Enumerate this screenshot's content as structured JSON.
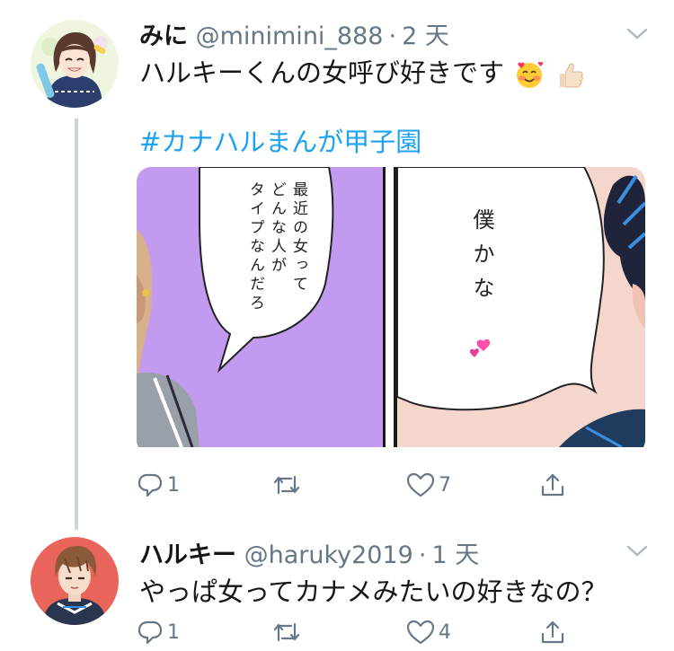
{
  "tweet1": {
    "name": "みに",
    "handle": "@minimini_888",
    "separator": "·",
    "time": "2 天",
    "text": "ハルキーくんの女呼び好きです",
    "hashtag": "#カナハルまんが甲子園",
    "emojis": [
      "smiling-face-with-hearts",
      "thumbs-up"
    ],
    "media": {
      "left_bubble": [
        "最近の女って",
        "どんな人が",
        "タイプなんだろ"
      ],
      "right_bubble": "僕かな"
    },
    "actions": {
      "reply_count": "1",
      "retweet_count": "",
      "like_count": "7"
    }
  },
  "tweet2": {
    "name": "ハルキー",
    "handle": "@haruky2019",
    "separator": "·",
    "time": "1 天",
    "text": "やっぱ女ってカナメみたいの好きなの？",
    "actions": {
      "reply_count": "1",
      "retweet_count": "",
      "like_count": "4"
    }
  },
  "colors": {
    "accent": "#1da1f2",
    "secondary_text": "#657786",
    "thread_line": "#ccd6dd"
  }
}
